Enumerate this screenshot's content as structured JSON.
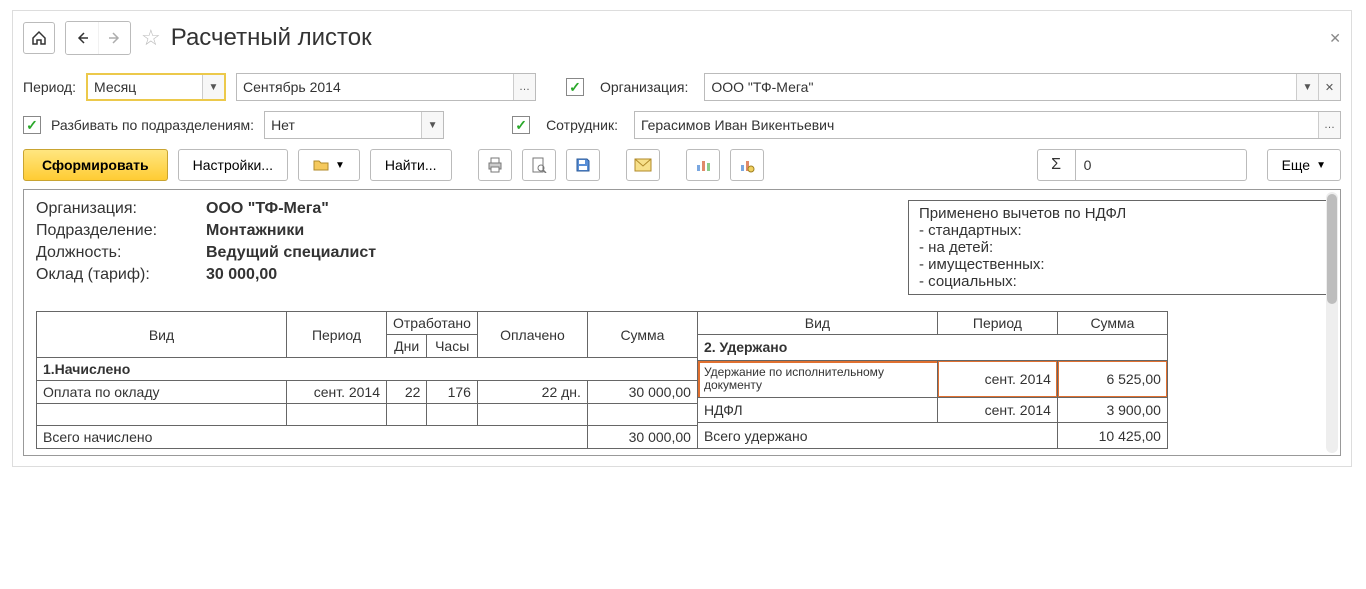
{
  "title": "Расчетный листок",
  "filters": {
    "period_label": "Период:",
    "period_type": "Месяц",
    "period_value": "Сентябрь 2014",
    "org_label": "Организация:",
    "org_value": "ООО \"ТФ-Мега\"",
    "split_label": "Разбивать по подразделениям:",
    "split_value": "Нет",
    "employee_label": "Сотрудник:",
    "employee_value": "Герасимов Иван Викентьевич"
  },
  "toolbar": {
    "generate": "Сформировать",
    "settings": "Настройки...",
    "find": "Найти...",
    "sigma_value": "0",
    "more": "Еще"
  },
  "report": {
    "left_labels": {
      "org": "Организация:",
      "dept": "Подразделение:",
      "position": "Должность:",
      "salary": "Оклад (тариф):"
    },
    "left_values": {
      "org": "ООО \"ТФ-Мега\"",
      "dept": "Монтажники",
      "position": "Ведущий специалист",
      "salary": "30 000,00"
    },
    "ndfl_box": {
      "header": "Применено вычетов по НДФЛ",
      "items": [
        "- стандартных:",
        "- на детей:",
        "- имущественных:",
        "- социальных:"
      ]
    },
    "left_table": {
      "headers": {
        "type": "Вид",
        "period": "Период",
        "worked": "Отработано",
        "days": "Дни",
        "hours": "Часы",
        "paid": "Оплачено",
        "sum": "Сумма"
      },
      "section": "1.Начислено",
      "row1": {
        "name": "Оплата по окладу",
        "period": "сент. 2014",
        "days": "22",
        "hours": "176",
        "paid": "22 дн.",
        "sum": "30 000,00"
      },
      "total": {
        "label": "Всего начислено",
        "sum": "30 000,00"
      }
    },
    "right_table": {
      "headers": {
        "type": "Вид",
        "period": "Период",
        "sum": "Сумма"
      },
      "section": "2. Удержано",
      "row1": {
        "name": "Удержание по исполнительному документу",
        "period": "сент. 2014",
        "sum": "6 525,00"
      },
      "row2": {
        "name": "НДФЛ",
        "period": "сент. 2014",
        "sum": "3 900,00"
      },
      "total": {
        "label": "Всего удержано",
        "sum": "10 425,00"
      }
    }
  }
}
